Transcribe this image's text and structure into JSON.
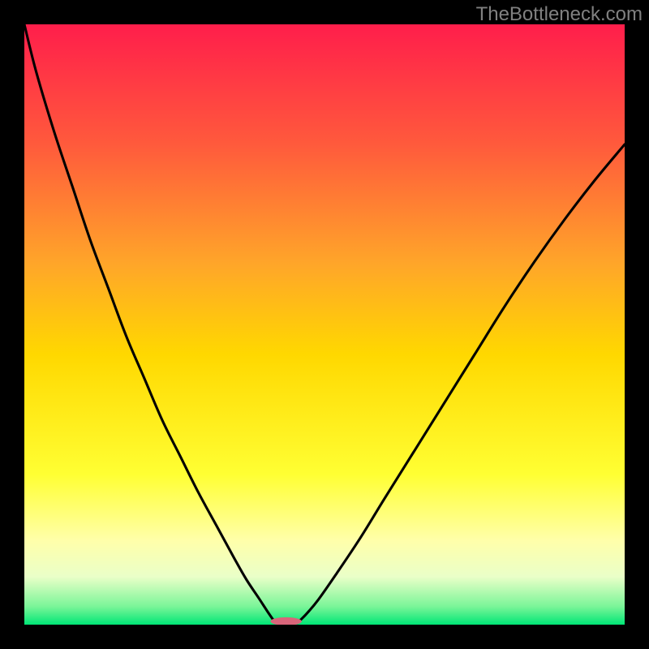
{
  "watermark": "TheBottleneck.com",
  "chart_data": {
    "type": "line",
    "title": "",
    "xlabel": "",
    "ylabel": "",
    "xlim": [
      0,
      100
    ],
    "ylim": [
      0,
      100
    ],
    "grid": false,
    "legend": false,
    "annotations": [],
    "background_gradient": {
      "stops": [
        {
          "offset": 0.0,
          "color": "#ff1e4b"
        },
        {
          "offset": 0.2,
          "color": "#ff5a3c"
        },
        {
          "offset": 0.4,
          "color": "#ffa629"
        },
        {
          "offset": 0.55,
          "color": "#ffd800"
        },
        {
          "offset": 0.75,
          "color": "#ffff33"
        },
        {
          "offset": 0.86,
          "color": "#ffffaa"
        },
        {
          "offset": 0.92,
          "color": "#eaffc8"
        },
        {
          "offset": 0.97,
          "color": "#7af598"
        },
        {
          "offset": 1.0,
          "color": "#00e676"
        }
      ]
    },
    "series": [
      {
        "name": "left-curve",
        "x": [
          0,
          2,
          5,
          8,
          11,
          14,
          17,
          20,
          23,
          26,
          29,
          32,
          35,
          37,
          39,
          40.5,
          41.8
        ],
        "y": [
          100,
          92,
          82,
          73,
          64,
          56,
          48,
          41,
          34,
          28,
          22,
          16.5,
          11,
          7.5,
          4.5,
          2.2,
          0.3
        ]
      },
      {
        "name": "right-curve",
        "x": [
          45.5,
          47,
          49,
          52,
          56,
          60,
          65,
          70,
          75,
          80,
          85,
          90,
          95,
          100
        ],
        "y": [
          0.3,
          1.8,
          4.2,
          8.5,
          14.5,
          21,
          29,
          37,
          45,
          53,
          60.5,
          67.5,
          74,
          80
        ]
      }
    ],
    "marker": {
      "name": "bottom-marker",
      "cx": 43.6,
      "cy": 0.55,
      "rx": 2.6,
      "ry": 0.68,
      "fill": "#d9657a"
    }
  }
}
